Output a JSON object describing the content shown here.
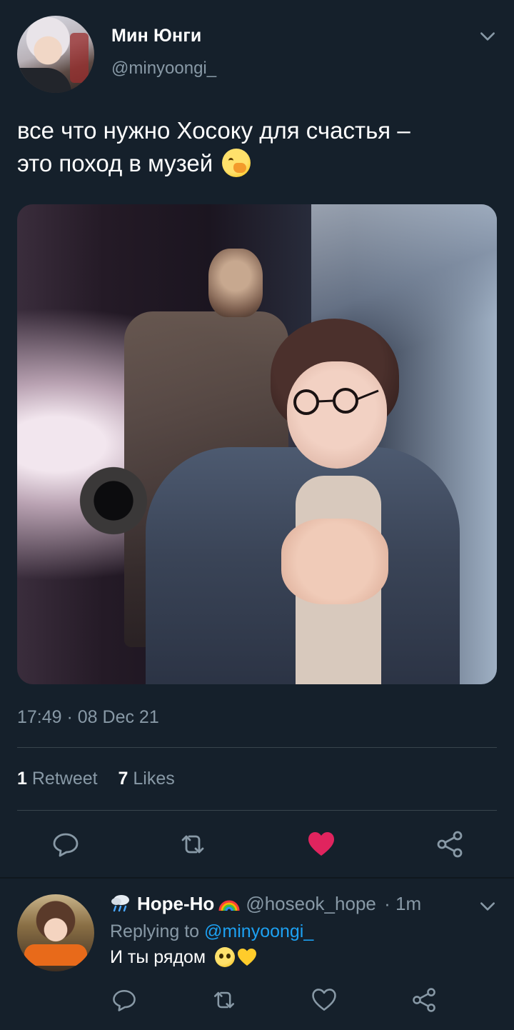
{
  "tweet": {
    "author_name": "Мин Юнги",
    "author_handle": "@minyoongi_",
    "text_line1": "все что нужно Хосоку для счастья –",
    "text_line2": "это поход в музей",
    "text_emoji": "face-with-hand-over-mouth",
    "timestamp": "17:49 · 08 Dec 21",
    "retweet_count": "1",
    "retweet_label": "Retweet",
    "like_count": "7",
    "like_label": "Likes",
    "liked": true,
    "like_color": "#e0245e"
  },
  "reply": {
    "author_name": "Hope-Ho",
    "author_handle": "@hoseok_hope",
    "time": "· 1m",
    "replying_prefix": "Replying to",
    "replying_to": "@minyoongi_",
    "text": "И ты рядом",
    "emojis": [
      "pleading-face",
      "yellow-heart"
    ]
  },
  "theme": {
    "background": "#15202b",
    "muted": "#8899a6",
    "accent": "#1da1f2",
    "divider": "#38444d"
  }
}
